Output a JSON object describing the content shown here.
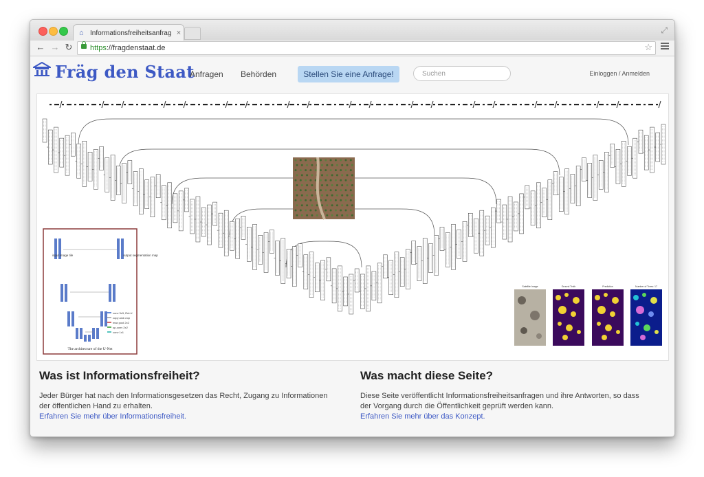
{
  "browser": {
    "tab_title": "Informationsfreiheitsanfrag",
    "tab_close": "×",
    "url_scheme": "https",
    "url_rest": "://fragdenstaat.de"
  },
  "site": {
    "logo_text": "Fräg den Staat",
    "nav": {
      "requests": "Anfragen",
      "authorities": "Behörden"
    },
    "cta": "Stellen Sie eine Anfrage!",
    "search_placeholder": "Suchen",
    "login": "Einloggen / Anmelden"
  },
  "hero": {
    "unet_caption": "The architecture of the U-Net",
    "unet_labels": {
      "input": "input image tile",
      "output": "output segmentation map"
    },
    "legend": [
      "conv 3x3, ReLU",
      "copy and crop",
      "max pool 2x2",
      "up-conv 2x2",
      "conv 1x1"
    ],
    "panel_titles": [
      "Satellite Image",
      "Ground Truth",
      "Prediction",
      "Number of Trees: 17"
    ],
    "accent_colors": {
      "ground_truth_bg": "#3b0a5c",
      "blob": "#f1d234",
      "trees_bg": "#0b1d8c"
    }
  },
  "info": {
    "left_title": "Was ist Informationsfreiheit?",
    "left_text": "Jeder Bürger hat nach den Informationsgesetzen das Recht, Zugang zu Informationen der öffentlichen Hand zu erhalten.",
    "left_link": "Erfahren Sie mehr über Informationsfreiheit.",
    "right_title": "Was macht diese Seite?",
    "right_text": "Diese Seite veröffentlicht Informationsfreiheitsanfragen und ihre Antworten, so dass der Vorgang durch die Öffentlichkeit geprüft werden kann.",
    "right_link": "Erfahren Sie mehr über das Konzept."
  }
}
